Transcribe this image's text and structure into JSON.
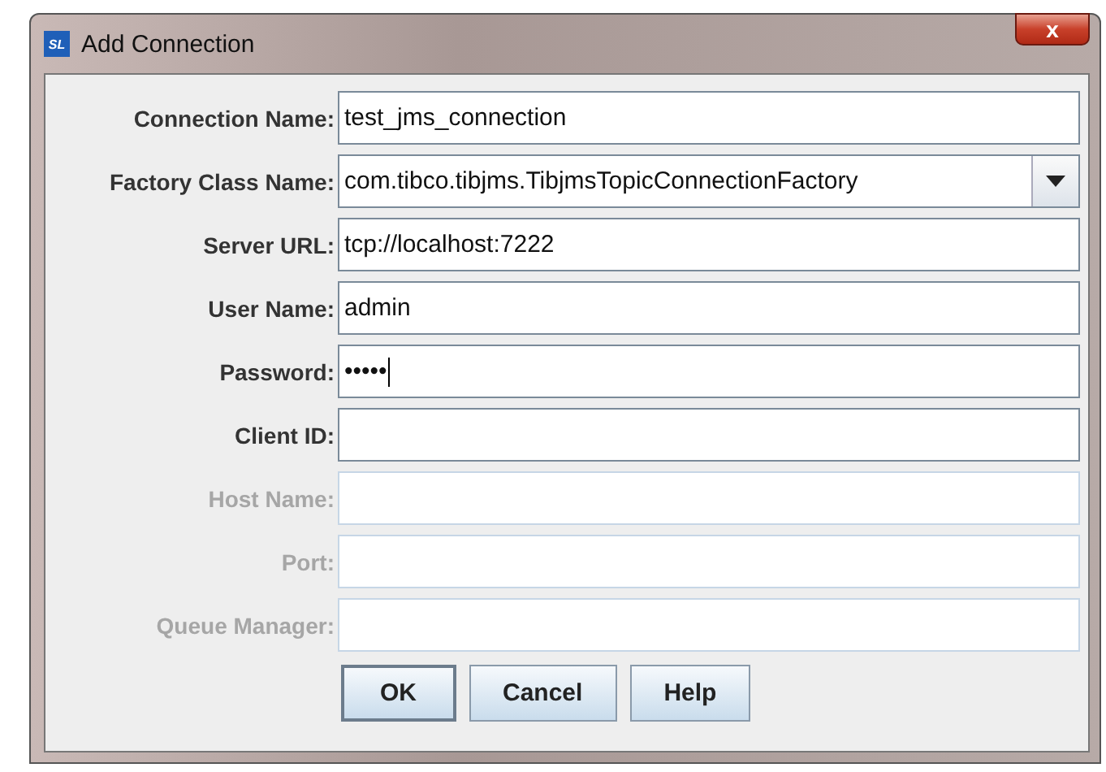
{
  "window": {
    "title": "Add Connection",
    "icon_text": "SL",
    "close": "x"
  },
  "fields": [
    {
      "label": "Connection Name:",
      "kind": "text",
      "value": "test_jms_connection",
      "disabled": false
    },
    {
      "label": "Factory Class Name:",
      "kind": "dropdown",
      "value": "com.tibco.tibjms.TibjmsTopicConnectionFactory",
      "disabled": false
    },
    {
      "label": "Server URL:",
      "kind": "text",
      "value": "tcp://localhost:7222",
      "disabled": false
    },
    {
      "label": "User Name:",
      "kind": "text",
      "value": "admin",
      "disabled": false
    },
    {
      "label": "Password:",
      "kind": "password",
      "value": "•••••",
      "disabled": false
    },
    {
      "label": "Client ID:",
      "kind": "text",
      "disabled": false
    },
    {
      "label": "Host Name:",
      "kind": "text",
      "disabled": true
    },
    {
      "label": "Port:",
      "kind": "text",
      "disabled": true
    },
    {
      "label": "Queue Manager:",
      "kind": "text",
      "disabled": true
    }
  ],
  "buttons": [
    {
      "label": "OK",
      "default": true
    },
    {
      "label": "Cancel",
      "default": false
    },
    {
      "label": "Help",
      "default": false
    }
  ]
}
